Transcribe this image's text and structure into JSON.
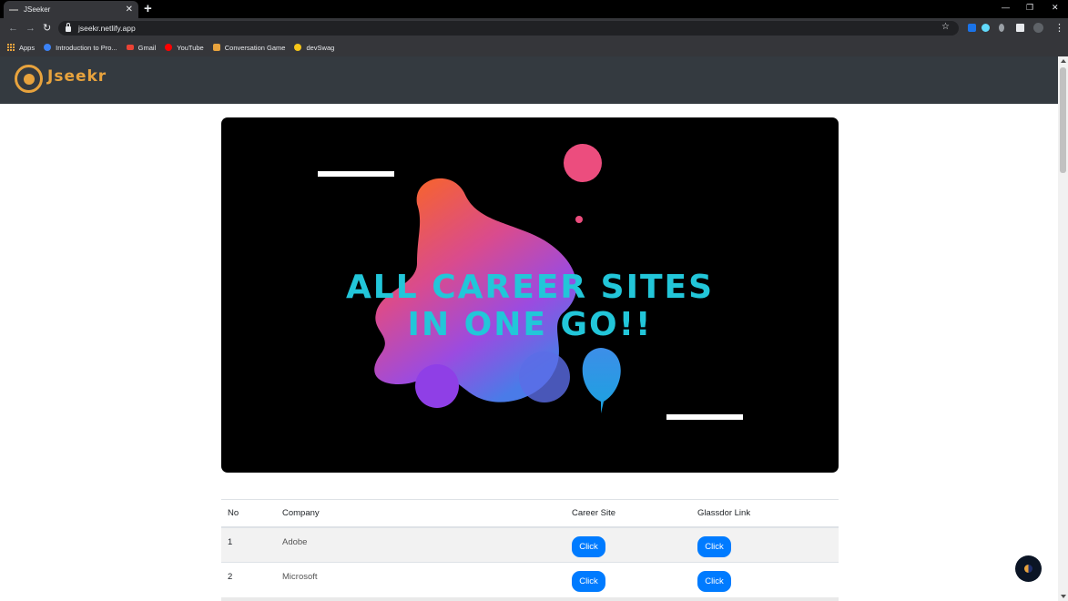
{
  "browser": {
    "tab_title": "JSeeker",
    "url": "jseekr.netlify.app",
    "bookmarks": [
      {
        "label": "Apps",
        "icon": "apps-grid-icon"
      },
      {
        "label": "Introduction to Pro...",
        "icon": "s-logo-icon",
        "color": "#3b82f6"
      },
      {
        "label": "Gmail",
        "icon": "gmail-icon",
        "color": "#ea4335"
      },
      {
        "label": "YouTube",
        "icon": "youtube-icon",
        "color": "#ff0000"
      },
      {
        "label": "Conversation Game",
        "icon": "game-icon",
        "color": "#e8a33d"
      },
      {
        "label": "devSwag",
        "icon": "smiley-icon",
        "color": "#f5c518"
      }
    ]
  },
  "header": {
    "logo_text": "Jseekr",
    "brand_color": "#e8a33d",
    "background": "#343a40"
  },
  "banner": {
    "line1": "ALL CAREER SITES",
    "line2": "IN ONE GO!!",
    "text_color": "#22c6d9"
  },
  "table": {
    "headers": [
      "No",
      "Company",
      "Career Site",
      "Glassdor Link"
    ],
    "rows": [
      {
        "no": "1",
        "company": "Adobe",
        "career": "Click",
        "glassdoor": "Click"
      },
      {
        "no": "2",
        "company": "Microsoft",
        "career": "Click",
        "glassdoor": "Click"
      }
    ],
    "button_color": "#007bff"
  }
}
